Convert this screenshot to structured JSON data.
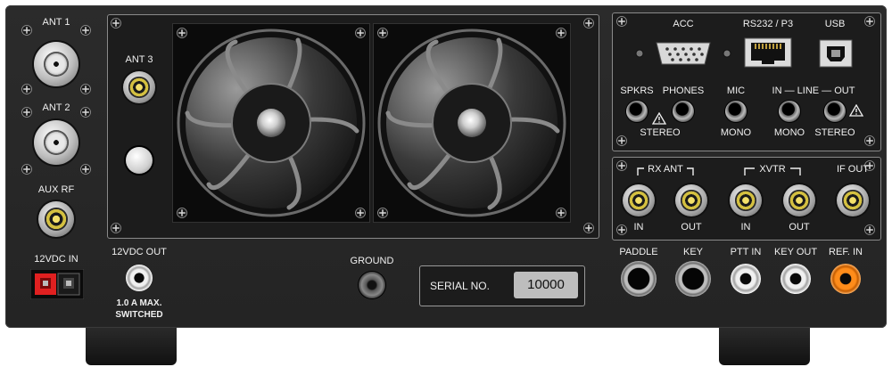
{
  "left_column": {
    "ant1_label": "ANT 1",
    "ant2_label": "ANT 2",
    "aux_rf_label": "AUX RF",
    "dc_in_label": "12VDC IN"
  },
  "fan_area": {
    "ant3_label": "ANT 3"
  },
  "bottom_middle": {
    "dc_out_label": "12VDC OUT",
    "dc_out_note_line1": "1.0 A MAX.",
    "dc_out_note_line2": "SWITCHED",
    "ground_label": "GROUND",
    "serial_label": "SERIAL NO.",
    "serial_value": "10000"
  },
  "top_right": {
    "acc_label": "ACC",
    "rs232_label": "RS232 / P3",
    "usb_label": "USB",
    "spkrs_label": "SPKRS",
    "phones_label": "PHONES",
    "stereo_label_1": "STEREO",
    "mic_label": "MIC",
    "mono_label_1": "MONO",
    "line_label": "IN — LINE — OUT",
    "mono_label_2": "MONO",
    "stereo_label_2": "STEREO"
  },
  "mid_right": {
    "rx_ant_label": "RX ANT",
    "xvtr_label": "XVTR",
    "if_out_label": "IF OUT",
    "rx_in_label": "IN",
    "rx_out_label": "OUT",
    "xvtr_in_label": "IN",
    "xvtr_out_label": "OUT"
  },
  "bottom_right": {
    "paddle_label": "PADDLE",
    "key_label": "KEY",
    "ptt_in_label": "PTT IN",
    "key_out_label": "KEY OUT",
    "ref_in_label": "REF. IN"
  },
  "colors": {
    "panel": "#262626",
    "label": "#f0f0f0",
    "bnc_center": "#f3e06a",
    "ref_in_orange": "#ff8c1a",
    "power_red": "#e02020",
    "power_black": "#111111"
  }
}
